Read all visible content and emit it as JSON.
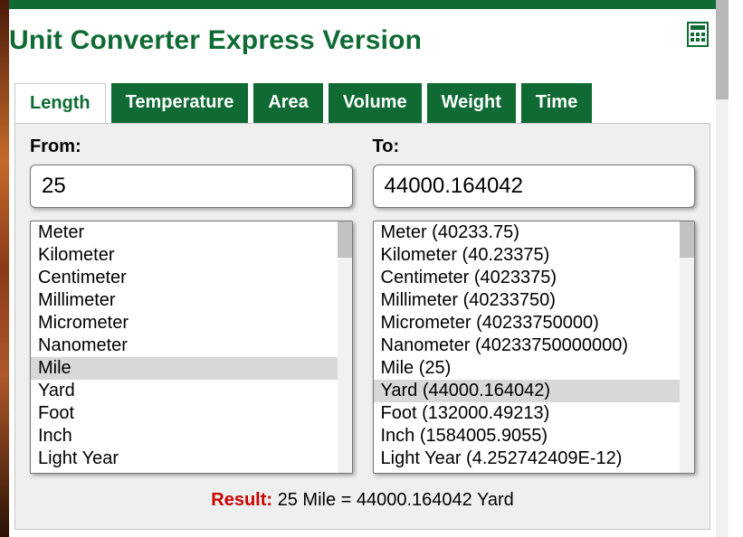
{
  "title": "Unit Converter Express Version",
  "icon": "calculator-icon",
  "tabs": [
    {
      "label": "Length",
      "active": true
    },
    {
      "label": "Temperature",
      "active": false
    },
    {
      "label": "Area",
      "active": false
    },
    {
      "label": "Volume",
      "active": false
    },
    {
      "label": "Weight",
      "active": false
    },
    {
      "label": "Time",
      "active": false
    }
  ],
  "from": {
    "label": "From:",
    "value": "25",
    "selected_index": 6,
    "options": [
      "Meter",
      "Kilometer",
      "Centimeter",
      "Millimeter",
      "Micrometer",
      "Nanometer",
      "Mile",
      "Yard",
      "Foot",
      "Inch",
      "Light Year"
    ]
  },
  "to": {
    "label": "To:",
    "value": "44000.164042",
    "selected_index": 7,
    "options": [
      "Meter (40233.75)",
      "Kilometer (40.23375)",
      "Centimeter (4023375)",
      "Millimeter (40233750)",
      "Micrometer (40233750000)",
      "Nanometer (40233750000000)",
      "Mile (25)",
      "Yard (44000.164042)",
      "Foot (132000.49213)",
      "Inch (1584005.9055)",
      "Light Year (4.252742409E-12)"
    ]
  },
  "result": {
    "label": "Result:",
    "text": "25 Mile = 44000.164042 Yard"
  }
}
